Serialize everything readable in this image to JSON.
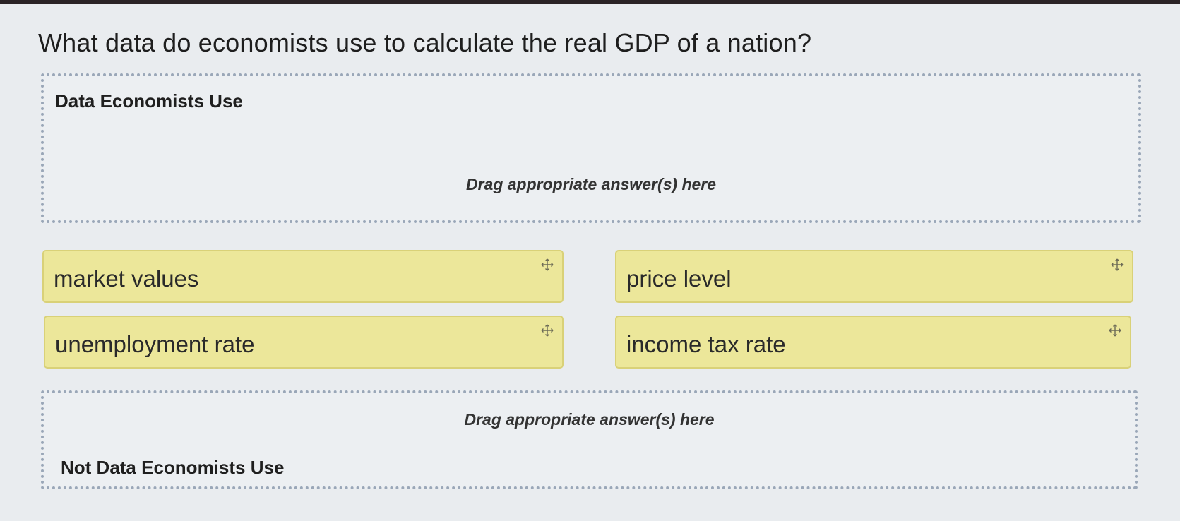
{
  "question": "What data do economists use to calculate the real GDP of a nation?",
  "drop_zones": [
    {
      "title": "Data Economists Use",
      "hint": "Drag appropriate answer(s) here"
    },
    {
      "title": "Not Data Economists Use",
      "hint": "Drag appropriate answer(s) here"
    }
  ],
  "answer_chips": [
    {
      "label": "market values",
      "icon": "move-icon"
    },
    {
      "label": "price level",
      "icon": "move-icon"
    },
    {
      "label": "unemployment rate",
      "icon": "move-icon"
    },
    {
      "label": "income tax rate",
      "icon": "move-icon"
    }
  ],
  "colors": {
    "chip_background": "#ece79a",
    "chip_border": "#d9d178",
    "dropzone_border": "#9aa7b8",
    "page_background": "#e9ecef"
  }
}
